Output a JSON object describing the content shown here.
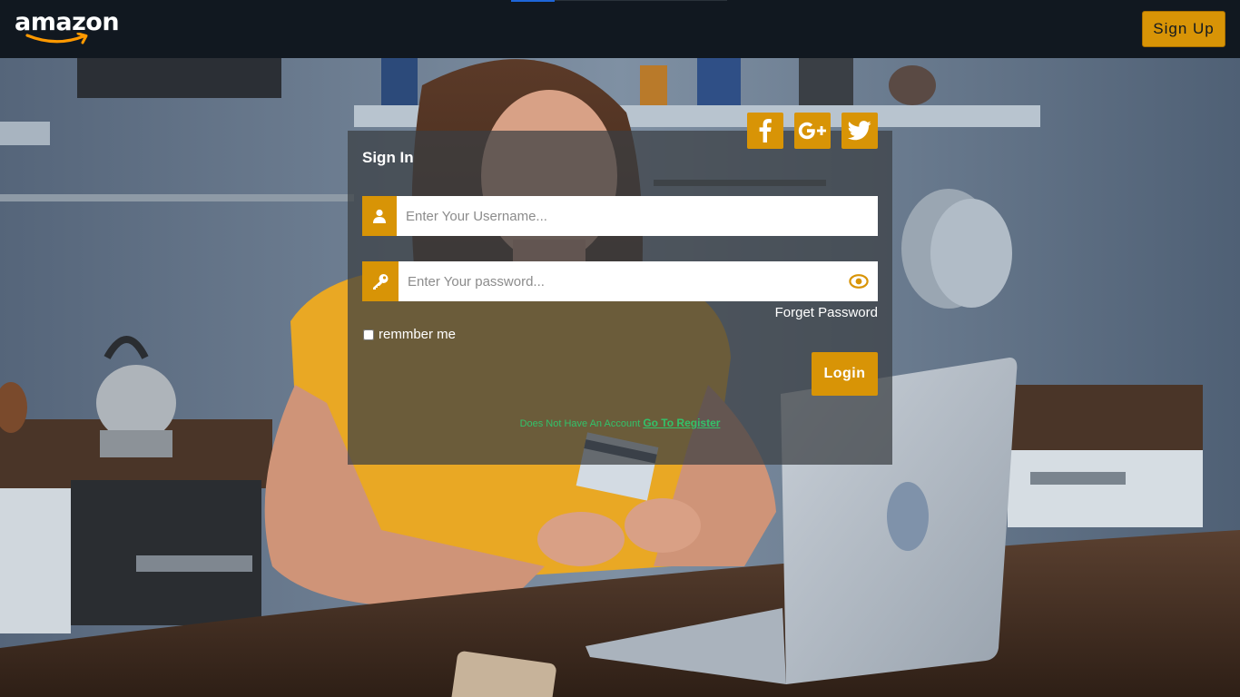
{
  "navbar": {
    "logo_text": "amazon",
    "signup_label": "Sign Up"
  },
  "signin": {
    "title": "Sign In",
    "social": [
      {
        "name": "facebook",
        "glyph": "f"
      },
      {
        "name": "google-plus",
        "glyph": "G+"
      },
      {
        "name": "twitter",
        "glyph": "twitter-bird"
      }
    ],
    "username": {
      "value": "",
      "placeholder": "Enter Your Username..."
    },
    "password": {
      "value": "",
      "placeholder": "Enter Your password..."
    },
    "forget_label": "Forget Password",
    "remember_label": "remmber me",
    "remember_checked": false,
    "login_label": "Login",
    "register_prompt": "Does Not Have An Account",
    "register_link": "Go To Register"
  },
  "colors": {
    "navbar_bg": "#111820",
    "accent": "#d89406",
    "link_green": "#33c26a",
    "panel_overlay": "rgba(58,62,66,0.72)"
  },
  "icons": {
    "username": "user-icon",
    "password": "key-icon",
    "show_password": "eye-icon"
  }
}
